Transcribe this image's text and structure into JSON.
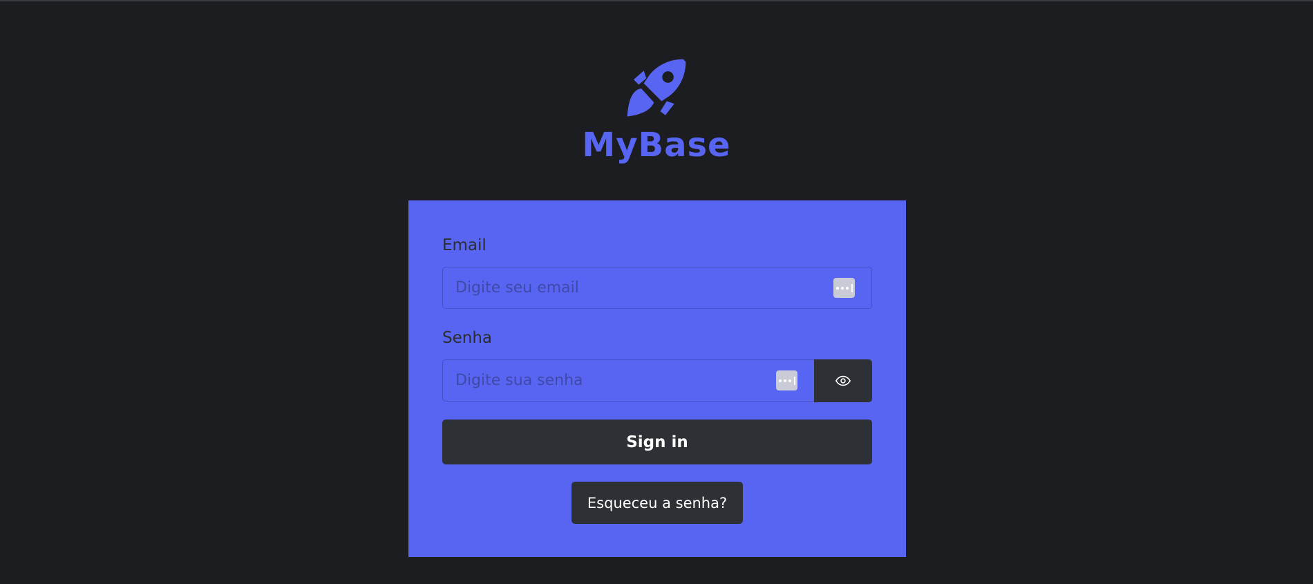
{
  "brand": {
    "name": "MyBase",
    "logo_icon": "rocket-icon",
    "accent_color": "#5865f2"
  },
  "form": {
    "email": {
      "label": "Email",
      "placeholder": "Digite seu email",
      "value": ""
    },
    "password": {
      "label": "Senha",
      "placeholder": "Digite sua senha",
      "value": "",
      "toggle_icon": "eye-icon"
    },
    "signin_label": "Sign in",
    "forgot_label": "Esqueceu a senha?"
  },
  "colors": {
    "background": "#1c1d21",
    "card": "#5865f2",
    "button": "#2d3035"
  }
}
